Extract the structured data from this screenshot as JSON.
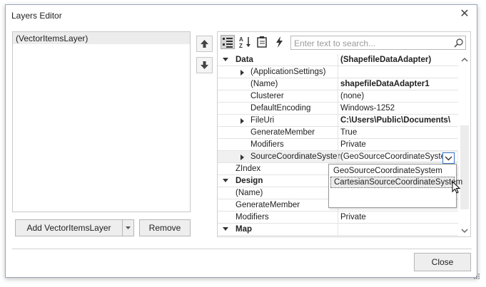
{
  "window": {
    "title": "Layers Editor"
  },
  "layers": {
    "items": [
      "(VectorItemsLayer)"
    ]
  },
  "buttons": {
    "add_label": "Add VectorItemsLayer",
    "remove_label": "Remove",
    "close_label": "Close"
  },
  "search": {
    "placeholder": "Enter text to search..."
  },
  "grid": {
    "rows": [
      {
        "name": "Data",
        "value": "(ShapefileDataAdapter)",
        "type": "category-expanded",
        "bold_value": true
      },
      {
        "name": "(ApplicationSettings)",
        "value": "",
        "type": "child-collapsed"
      },
      {
        "name": "(Name)",
        "value": "shapefileDataAdapter1",
        "type": "child",
        "bold_value": true
      },
      {
        "name": "Clusterer",
        "value": "(none)",
        "type": "child"
      },
      {
        "name": "DefaultEncoding",
        "value": "Windows-1252",
        "type": "child"
      },
      {
        "name": "FileUri",
        "value": "C:\\Users\\Public\\Documents\\",
        "type": "child-collapsed",
        "bold_value": true
      },
      {
        "name": "GenerateMember",
        "value": "True",
        "type": "child"
      },
      {
        "name": "Modifiers",
        "value": "Private",
        "type": "child"
      },
      {
        "name": "SourceCoordinateSystem",
        "value": "(GeoSourceCoordinateSystem)",
        "type": "child-collapsed-selected"
      },
      {
        "name": "ZIndex",
        "value": "",
        "type": "plain"
      },
      {
        "name": "Design",
        "value": "",
        "type": "category-expanded"
      },
      {
        "name": "(Name)",
        "value": "",
        "type": "plain"
      },
      {
        "name": "GenerateMember",
        "value": "",
        "type": "plain"
      },
      {
        "name": "Modifiers",
        "value": "Private",
        "type": "plain"
      },
      {
        "name": "Map",
        "value": "",
        "type": "category-expanded"
      }
    ]
  },
  "dropdown": {
    "options": [
      "GeoSourceCoordinateSystem",
      "CartesianSourceCoordinateSystem"
    ],
    "highlighted": "CartesianSourceCoordinateSystem"
  },
  "icons": {
    "toolbar": [
      "categorized-icon",
      "alphabetical-icon",
      "properties-icon",
      "events-icon"
    ],
    "move": [
      "arrow-up-icon",
      "arrow-down-icon"
    ]
  }
}
